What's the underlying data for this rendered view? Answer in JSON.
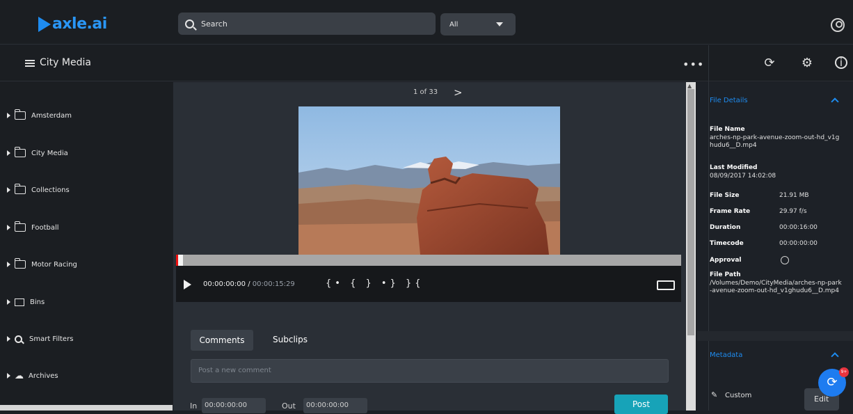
{
  "app": {
    "logo_text": "axle.ai"
  },
  "header": {
    "search_placeholder": "Search",
    "scope_value": "All"
  },
  "toolbar": {
    "breadcrumb": "City Media",
    "more_label": "•••"
  },
  "sidebar": {
    "items": [
      {
        "label": "Amsterdam",
        "icon": "folder-icon"
      },
      {
        "label": "City Media",
        "icon": "folder-icon"
      },
      {
        "label": "Collections",
        "icon": "folder-icon"
      },
      {
        "label": "Football",
        "icon": "folder-icon"
      },
      {
        "label": "Motor Racing",
        "icon": "folder-icon"
      },
      {
        "label": "Bins",
        "icon": "bins-icon"
      },
      {
        "label": "Smart Filters",
        "icon": "search-icon"
      },
      {
        "label": "Archives",
        "icon": "cloud-icon"
      }
    ]
  },
  "player": {
    "pager": "1 of 33",
    "current_time": "00:00:00:00",
    "separator": " / ",
    "total_time": "00:00:15:29",
    "markers": "{• { } •} }{"
  },
  "comments": {
    "tabs": [
      "Comments",
      "Subclips"
    ],
    "placeholder": "Post a new comment",
    "in_label": "In",
    "in_value": "00:00:00:00",
    "out_label": "Out",
    "out_value": "00:00:00:00",
    "post_label": "Post"
  },
  "details": {
    "title": "File Details",
    "file_name_label": "File Name",
    "file_name": "arches-np-park-avenue-zoom-out-hd_v1ghudu6__D.mp4",
    "last_modified_label": "Last Modified",
    "last_modified": "08/09/2017 14:02:08",
    "rows": [
      {
        "label": "File Size",
        "value": "21.91 MB"
      },
      {
        "label": "Frame Rate",
        "value": "29.97 f/s"
      },
      {
        "label": "Duration",
        "value": "00:00:16:00"
      },
      {
        "label": "Timecode",
        "value": "00:00:00:00"
      }
    ],
    "approval_label": "Approval",
    "file_path_label": "File Path",
    "file_path": "/Volumes/Demo/CityMedia/arches-np-park-avenue-zoom-out-hd_v1ghudu6__D.mp4"
  },
  "metadata": {
    "title": "Metadata",
    "custom_label": "Custom",
    "edit_label": "Edit",
    "fab_badge": "9+"
  },
  "colors": {
    "accent": "#1e8cf0",
    "post_button": "#17a3b8",
    "background": "#1b1e22"
  }
}
